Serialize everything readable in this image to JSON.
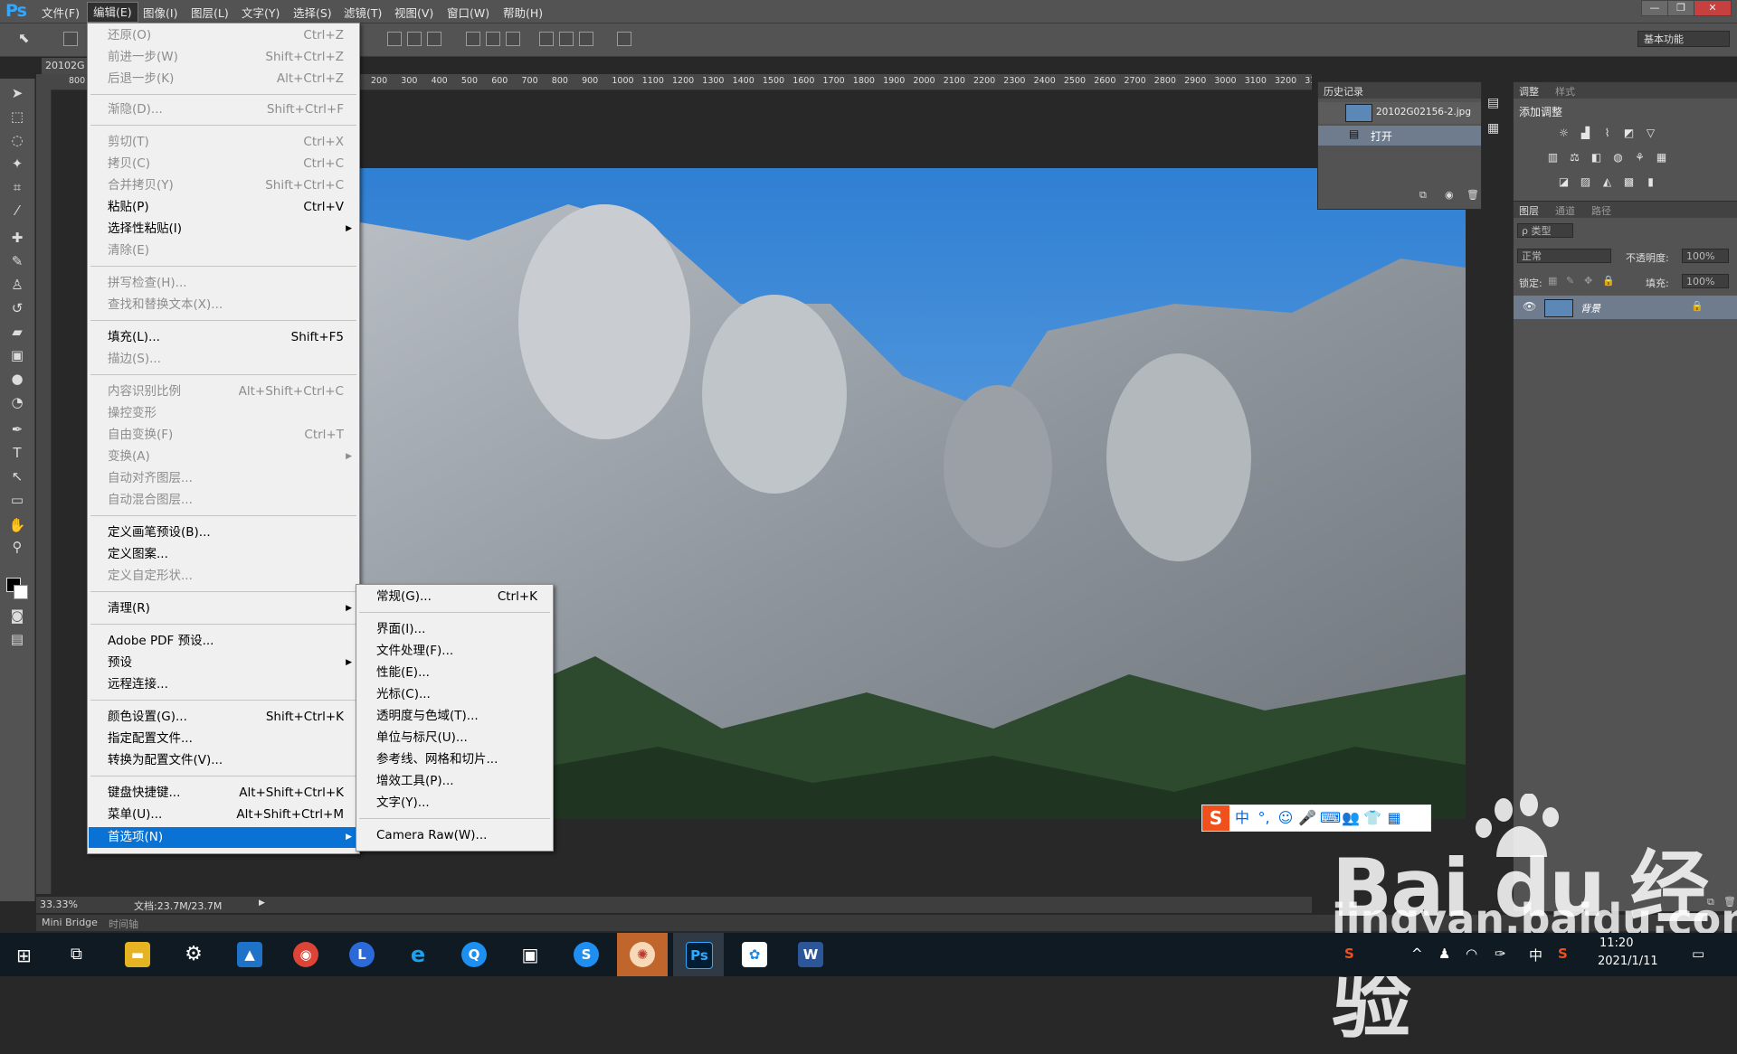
{
  "app": {
    "logo": "Ps"
  },
  "menubar": {
    "items": [
      "文件(F)",
      "编辑(E)",
      "图像(I)",
      "图层(L)",
      "文字(Y)",
      "选择(S)",
      "滤镜(T)",
      "视图(V)",
      "窗口(W)",
      "帮助(H)"
    ],
    "window_buttons": [
      "—",
      "❐",
      "✕"
    ]
  },
  "optionsbar": {
    "workspace": "基本功能"
  },
  "document": {
    "tab": "20102G",
    "ruler_ticks": [
      "800",
      "200",
      "300",
      "400",
      "500",
      "600",
      "700",
      "800",
      "900",
      "1000",
      "1100",
      "1200",
      "1300",
      "1400",
      "1500",
      "1600",
      "1700",
      "1800",
      "1900",
      "2000",
      "2100",
      "2200",
      "2300",
      "2400",
      "2500",
      "2600",
      "2700",
      "2800",
      "2900",
      "3000",
      "3100",
      "3200",
      "33"
    ],
    "zoom": "33.33%",
    "doc_size": "文档:23.7M/23.7M"
  },
  "bottom_tabs": [
    "Mini Bridge",
    "时间轴"
  ],
  "edit_menu": {
    "items": [
      {
        "label": "还原(O)",
        "shortcut": "Ctrl+Z",
        "disabled": true
      },
      {
        "label": "前进一步(W)",
        "shortcut": "Shift+Ctrl+Z",
        "disabled": true
      },
      {
        "label": "后退一步(K)",
        "shortcut": "Alt+Ctrl+Z",
        "disabled": true
      },
      {
        "label": "渐隐(D)...",
        "shortcut": "Shift+Ctrl+F",
        "disabled": true
      },
      {
        "label": "剪切(T)",
        "shortcut": "Ctrl+X",
        "disabled": true
      },
      {
        "label": "拷贝(C)",
        "shortcut": "Ctrl+C",
        "disabled": true
      },
      {
        "label": "合并拷贝(Y)",
        "shortcut": "Shift+Ctrl+C",
        "disabled": true
      },
      {
        "label": "粘贴(P)",
        "shortcut": "Ctrl+V",
        "disabled": false
      },
      {
        "label": "选择性粘贴(I)",
        "shortcut": "",
        "disabled": false
      },
      {
        "label": "清除(E)",
        "shortcut": "",
        "disabled": true
      },
      {
        "label": "拼写检查(H)...",
        "shortcut": "",
        "disabled": true
      },
      {
        "label": "查找和替换文本(X)...",
        "shortcut": "",
        "disabled": true
      },
      {
        "label": "填充(L)...",
        "shortcut": "Shift+F5",
        "disabled": false
      },
      {
        "label": "描边(S)...",
        "shortcut": "",
        "disabled": true
      },
      {
        "label": "内容识别比例",
        "shortcut": "Alt+Shift+Ctrl+C",
        "disabled": true
      },
      {
        "label": "操控变形",
        "shortcut": "",
        "disabled": true
      },
      {
        "label": "自由变换(F)",
        "shortcut": "Ctrl+T",
        "disabled": true
      },
      {
        "label": "变换(A)",
        "shortcut": "",
        "disabled": true
      },
      {
        "label": "自动对齐图层...",
        "shortcut": "",
        "disabled": true
      },
      {
        "label": "自动混合图层...",
        "shortcut": "",
        "disabled": true
      },
      {
        "label": "定义画笔预设(B)...",
        "shortcut": "",
        "disabled": false
      },
      {
        "label": "定义图案...",
        "shortcut": "",
        "disabled": false
      },
      {
        "label": "定义自定形状...",
        "shortcut": "",
        "disabled": true
      },
      {
        "label": "清理(R)",
        "shortcut": "",
        "disabled": false
      },
      {
        "label": "Adobe PDF 预设...",
        "shortcut": "",
        "disabled": false
      },
      {
        "label": "预设",
        "shortcut": "",
        "disabled": false
      },
      {
        "label": "远程连接...",
        "shortcut": "",
        "disabled": false
      },
      {
        "label": "颜色设置(G)...",
        "shortcut": "Shift+Ctrl+K",
        "disabled": false
      },
      {
        "label": "指定配置文件...",
        "shortcut": "",
        "disabled": false
      },
      {
        "label": "转换为配置文件(V)...",
        "shortcut": "",
        "disabled": false
      },
      {
        "label": "键盘快捷键...",
        "shortcut": "Alt+Shift+Ctrl+K",
        "disabled": false
      },
      {
        "label": "菜单(U)...",
        "shortcut": "Alt+Shift+Ctrl+M",
        "disabled": false
      },
      {
        "label": "首选项(N)",
        "shortcut": "",
        "disabled": false
      }
    ]
  },
  "pref_menu": {
    "items": [
      {
        "label": "常规(G)...",
        "shortcut": "Ctrl+K"
      },
      {
        "label": "界面(I)...",
        "shortcut": ""
      },
      {
        "label": "文件处理(F)...",
        "shortcut": ""
      },
      {
        "label": "性能(E)...",
        "shortcut": ""
      },
      {
        "label": "光标(C)...",
        "shortcut": ""
      },
      {
        "label": "透明度与色域(T)...",
        "shortcut": ""
      },
      {
        "label": "单位与标尺(U)...",
        "shortcut": ""
      },
      {
        "label": "参考线、网格和切片...",
        "shortcut": ""
      },
      {
        "label": "增效工具(P)...",
        "shortcut": ""
      },
      {
        "label": "文字(Y)...",
        "shortcut": ""
      },
      {
        "label": "Camera Raw(W)...",
        "shortcut": ""
      }
    ]
  },
  "history_panel": {
    "title": "历史记录",
    "snapshot": "20102G02156-2.jpg",
    "step": "打开"
  },
  "adjust_panel": {
    "tabs": [
      "调整",
      "样式"
    ],
    "title": "添加调整"
  },
  "layers_panel": {
    "tabs": [
      "图层",
      "通道",
      "路径"
    ],
    "filter": "ρ 类型",
    "blend_mode": "正常",
    "opacity_label": "不透明度:",
    "opacity_value": "100%",
    "lock_label": "锁定:",
    "fill_label": "填充:",
    "fill_value": "100%",
    "layer_name": "背景"
  },
  "ime": {
    "mode": "中"
  },
  "watermark": {
    "line1": "Bai  du 经验",
    "line2": "jingyan.baidu.com"
  },
  "taskbar": {
    "tray_lang": "中",
    "time": "11:20",
    "date": "2021/1/11"
  }
}
